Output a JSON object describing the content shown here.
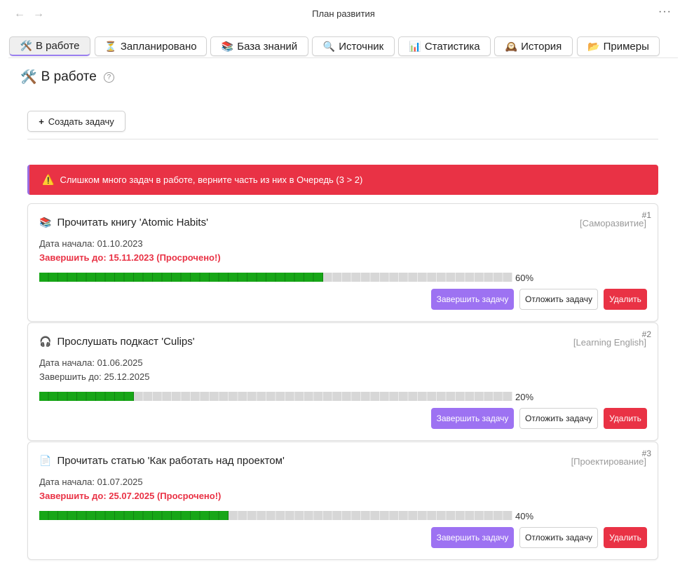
{
  "window": {
    "title": "План развития",
    "back_icon": "←",
    "forward_icon": "→",
    "more_icon": "···"
  },
  "tabs": [
    {
      "icon": "🛠️",
      "label": "В работе",
      "active": true
    },
    {
      "icon": "⏳",
      "label": "Запланировано"
    },
    {
      "icon": "📚",
      "label": "База знаний"
    },
    {
      "icon": "🔍",
      "label": "Источник"
    },
    {
      "icon": "📊",
      "label": "Статистика"
    },
    {
      "icon": "🕰️",
      "label": "История"
    },
    {
      "icon": "📂",
      "label": "Примеры"
    }
  ],
  "page": {
    "icon": "🛠️",
    "title": "В работе",
    "help": "?"
  },
  "create_button": {
    "icon": "+",
    "label": "Создать задачу"
  },
  "alert": {
    "icon": "⚠️",
    "text": "Слишком много задач в работе, верните часть из них в Очередь (3 > 2)"
  },
  "tasks": [
    {
      "number": "#1",
      "icon": "📚",
      "title": "Прочитать книгу 'Atomic Habits'",
      "category": "[Саморазвитие]",
      "start": "Дата начала: 01.10.2023",
      "due": "Завершить до: 15.11.2023 (Просрочено!)",
      "overdue": true,
      "progress": 60,
      "progress_label": "60%"
    },
    {
      "number": "#2",
      "icon": "🎧",
      "title": "Прослушать подкаст 'Culips'",
      "category": "[Learning English]",
      "start": "Дата начала: 01.06.2025",
      "due": "Завершить до: 25.12.2025",
      "overdue": false,
      "progress": 20,
      "progress_label": "20%"
    },
    {
      "number": "#3",
      "icon": "📄",
      "title": "Прочитать статью 'Как работать над проектом'",
      "category": "[Проектирование]",
      "start": "Дата начала: 01.07.2025",
      "due": "Завершить до: 25.07.2025 (Просрочено!)",
      "overdue": true,
      "progress": 40,
      "progress_label": "40%"
    }
  ],
  "task_actions": {
    "complete": "Завершить задачу",
    "postpone": "Отложить задачу",
    "delete": "Удалить"
  },
  "colors": {
    "accent": "#9d72f2",
    "danger": "#e93245",
    "progress": "#17a617"
  }
}
